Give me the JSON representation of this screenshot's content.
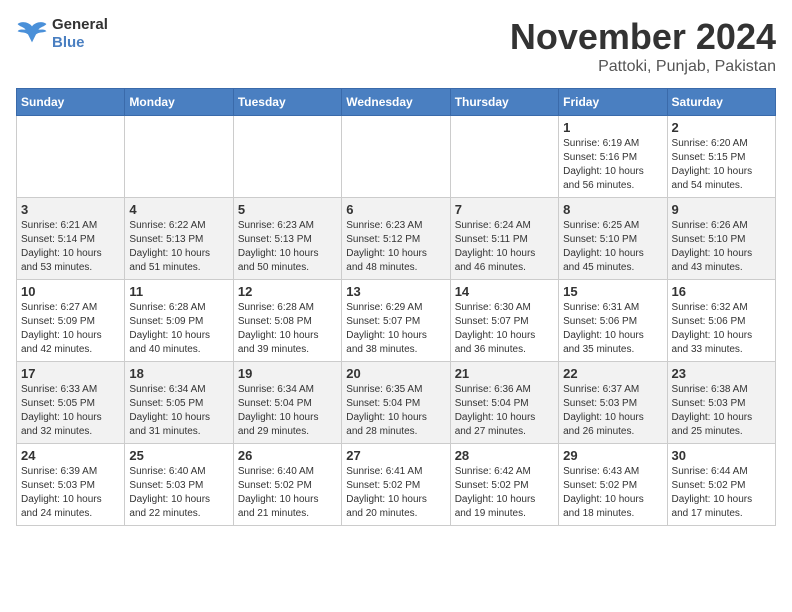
{
  "header": {
    "logo_line1": "General",
    "logo_line2": "Blue",
    "month_title": "November 2024",
    "location": "Pattoki, Punjab, Pakistan"
  },
  "weekdays": [
    "Sunday",
    "Monday",
    "Tuesday",
    "Wednesday",
    "Thursday",
    "Friday",
    "Saturday"
  ],
  "weeks": [
    [
      {
        "day": "",
        "info": ""
      },
      {
        "day": "",
        "info": ""
      },
      {
        "day": "",
        "info": ""
      },
      {
        "day": "",
        "info": ""
      },
      {
        "day": "",
        "info": ""
      },
      {
        "day": "1",
        "info": "Sunrise: 6:19 AM\nSunset: 5:16 PM\nDaylight: 10 hours\nand 56 minutes."
      },
      {
        "day": "2",
        "info": "Sunrise: 6:20 AM\nSunset: 5:15 PM\nDaylight: 10 hours\nand 54 minutes."
      }
    ],
    [
      {
        "day": "3",
        "info": "Sunrise: 6:21 AM\nSunset: 5:14 PM\nDaylight: 10 hours\nand 53 minutes."
      },
      {
        "day": "4",
        "info": "Sunrise: 6:22 AM\nSunset: 5:13 PM\nDaylight: 10 hours\nand 51 minutes."
      },
      {
        "day": "5",
        "info": "Sunrise: 6:23 AM\nSunset: 5:13 PM\nDaylight: 10 hours\nand 50 minutes."
      },
      {
        "day": "6",
        "info": "Sunrise: 6:23 AM\nSunset: 5:12 PM\nDaylight: 10 hours\nand 48 minutes."
      },
      {
        "day": "7",
        "info": "Sunrise: 6:24 AM\nSunset: 5:11 PM\nDaylight: 10 hours\nand 46 minutes."
      },
      {
        "day": "8",
        "info": "Sunrise: 6:25 AM\nSunset: 5:10 PM\nDaylight: 10 hours\nand 45 minutes."
      },
      {
        "day": "9",
        "info": "Sunrise: 6:26 AM\nSunset: 5:10 PM\nDaylight: 10 hours\nand 43 minutes."
      }
    ],
    [
      {
        "day": "10",
        "info": "Sunrise: 6:27 AM\nSunset: 5:09 PM\nDaylight: 10 hours\nand 42 minutes."
      },
      {
        "day": "11",
        "info": "Sunrise: 6:28 AM\nSunset: 5:09 PM\nDaylight: 10 hours\nand 40 minutes."
      },
      {
        "day": "12",
        "info": "Sunrise: 6:28 AM\nSunset: 5:08 PM\nDaylight: 10 hours\nand 39 minutes."
      },
      {
        "day": "13",
        "info": "Sunrise: 6:29 AM\nSunset: 5:07 PM\nDaylight: 10 hours\nand 38 minutes."
      },
      {
        "day": "14",
        "info": "Sunrise: 6:30 AM\nSunset: 5:07 PM\nDaylight: 10 hours\nand 36 minutes."
      },
      {
        "day": "15",
        "info": "Sunrise: 6:31 AM\nSunset: 5:06 PM\nDaylight: 10 hours\nand 35 minutes."
      },
      {
        "day": "16",
        "info": "Sunrise: 6:32 AM\nSunset: 5:06 PM\nDaylight: 10 hours\nand 33 minutes."
      }
    ],
    [
      {
        "day": "17",
        "info": "Sunrise: 6:33 AM\nSunset: 5:05 PM\nDaylight: 10 hours\nand 32 minutes."
      },
      {
        "day": "18",
        "info": "Sunrise: 6:34 AM\nSunset: 5:05 PM\nDaylight: 10 hours\nand 31 minutes."
      },
      {
        "day": "19",
        "info": "Sunrise: 6:34 AM\nSunset: 5:04 PM\nDaylight: 10 hours\nand 29 minutes."
      },
      {
        "day": "20",
        "info": "Sunrise: 6:35 AM\nSunset: 5:04 PM\nDaylight: 10 hours\nand 28 minutes."
      },
      {
        "day": "21",
        "info": "Sunrise: 6:36 AM\nSunset: 5:04 PM\nDaylight: 10 hours\nand 27 minutes."
      },
      {
        "day": "22",
        "info": "Sunrise: 6:37 AM\nSunset: 5:03 PM\nDaylight: 10 hours\nand 26 minutes."
      },
      {
        "day": "23",
        "info": "Sunrise: 6:38 AM\nSunset: 5:03 PM\nDaylight: 10 hours\nand 25 minutes."
      }
    ],
    [
      {
        "day": "24",
        "info": "Sunrise: 6:39 AM\nSunset: 5:03 PM\nDaylight: 10 hours\nand 24 minutes."
      },
      {
        "day": "25",
        "info": "Sunrise: 6:40 AM\nSunset: 5:03 PM\nDaylight: 10 hours\nand 22 minutes."
      },
      {
        "day": "26",
        "info": "Sunrise: 6:40 AM\nSunset: 5:02 PM\nDaylight: 10 hours\nand 21 minutes."
      },
      {
        "day": "27",
        "info": "Sunrise: 6:41 AM\nSunset: 5:02 PM\nDaylight: 10 hours\nand 20 minutes."
      },
      {
        "day": "28",
        "info": "Sunrise: 6:42 AM\nSunset: 5:02 PM\nDaylight: 10 hours\nand 19 minutes."
      },
      {
        "day": "29",
        "info": "Sunrise: 6:43 AM\nSunset: 5:02 PM\nDaylight: 10 hours\nand 18 minutes."
      },
      {
        "day": "30",
        "info": "Sunrise: 6:44 AM\nSunset: 5:02 PM\nDaylight: 10 hours\nand 17 minutes."
      }
    ]
  ]
}
